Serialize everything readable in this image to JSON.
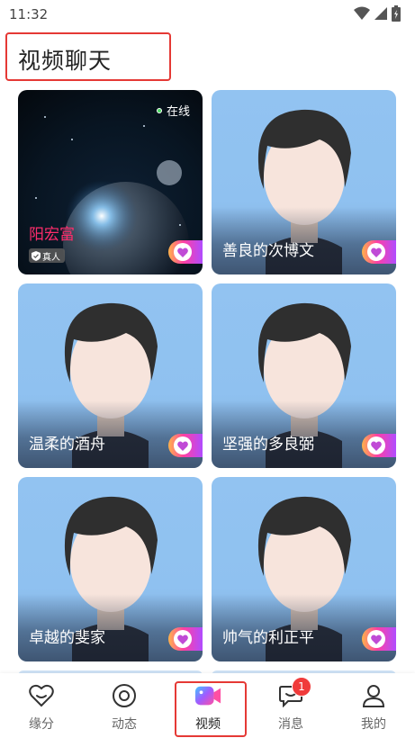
{
  "status_bar": {
    "time": "11:32"
  },
  "header": {
    "title": "视频聊天"
  },
  "cards": [
    {
      "name": "阳宏富",
      "online_label": "在线",
      "real_label": "真人",
      "type": "photo"
    },
    {
      "name": "善良的次博文",
      "type": "avatar"
    },
    {
      "name": "温柔的酒舟",
      "type": "avatar"
    },
    {
      "name": "坚强的多良弼",
      "type": "avatar"
    },
    {
      "name": "卓越的斐家",
      "type": "avatar"
    },
    {
      "name": "帅气的利正平",
      "type": "avatar"
    }
  ],
  "nav": {
    "items": [
      {
        "label": "缘分",
        "icon": "heart-icon"
      },
      {
        "label": "动态",
        "icon": "circle-dot-icon"
      },
      {
        "label": "视频",
        "icon": "video-camera-icon",
        "active": true
      },
      {
        "label": "消息",
        "icon": "chat-bubble-icon",
        "badge": "1"
      },
      {
        "label": "我的",
        "icon": "person-icon"
      }
    ]
  },
  "colors": {
    "accent_red": "#e53935",
    "badge_red": "#f03b3b",
    "card_blue": "#92c3f1"
  }
}
